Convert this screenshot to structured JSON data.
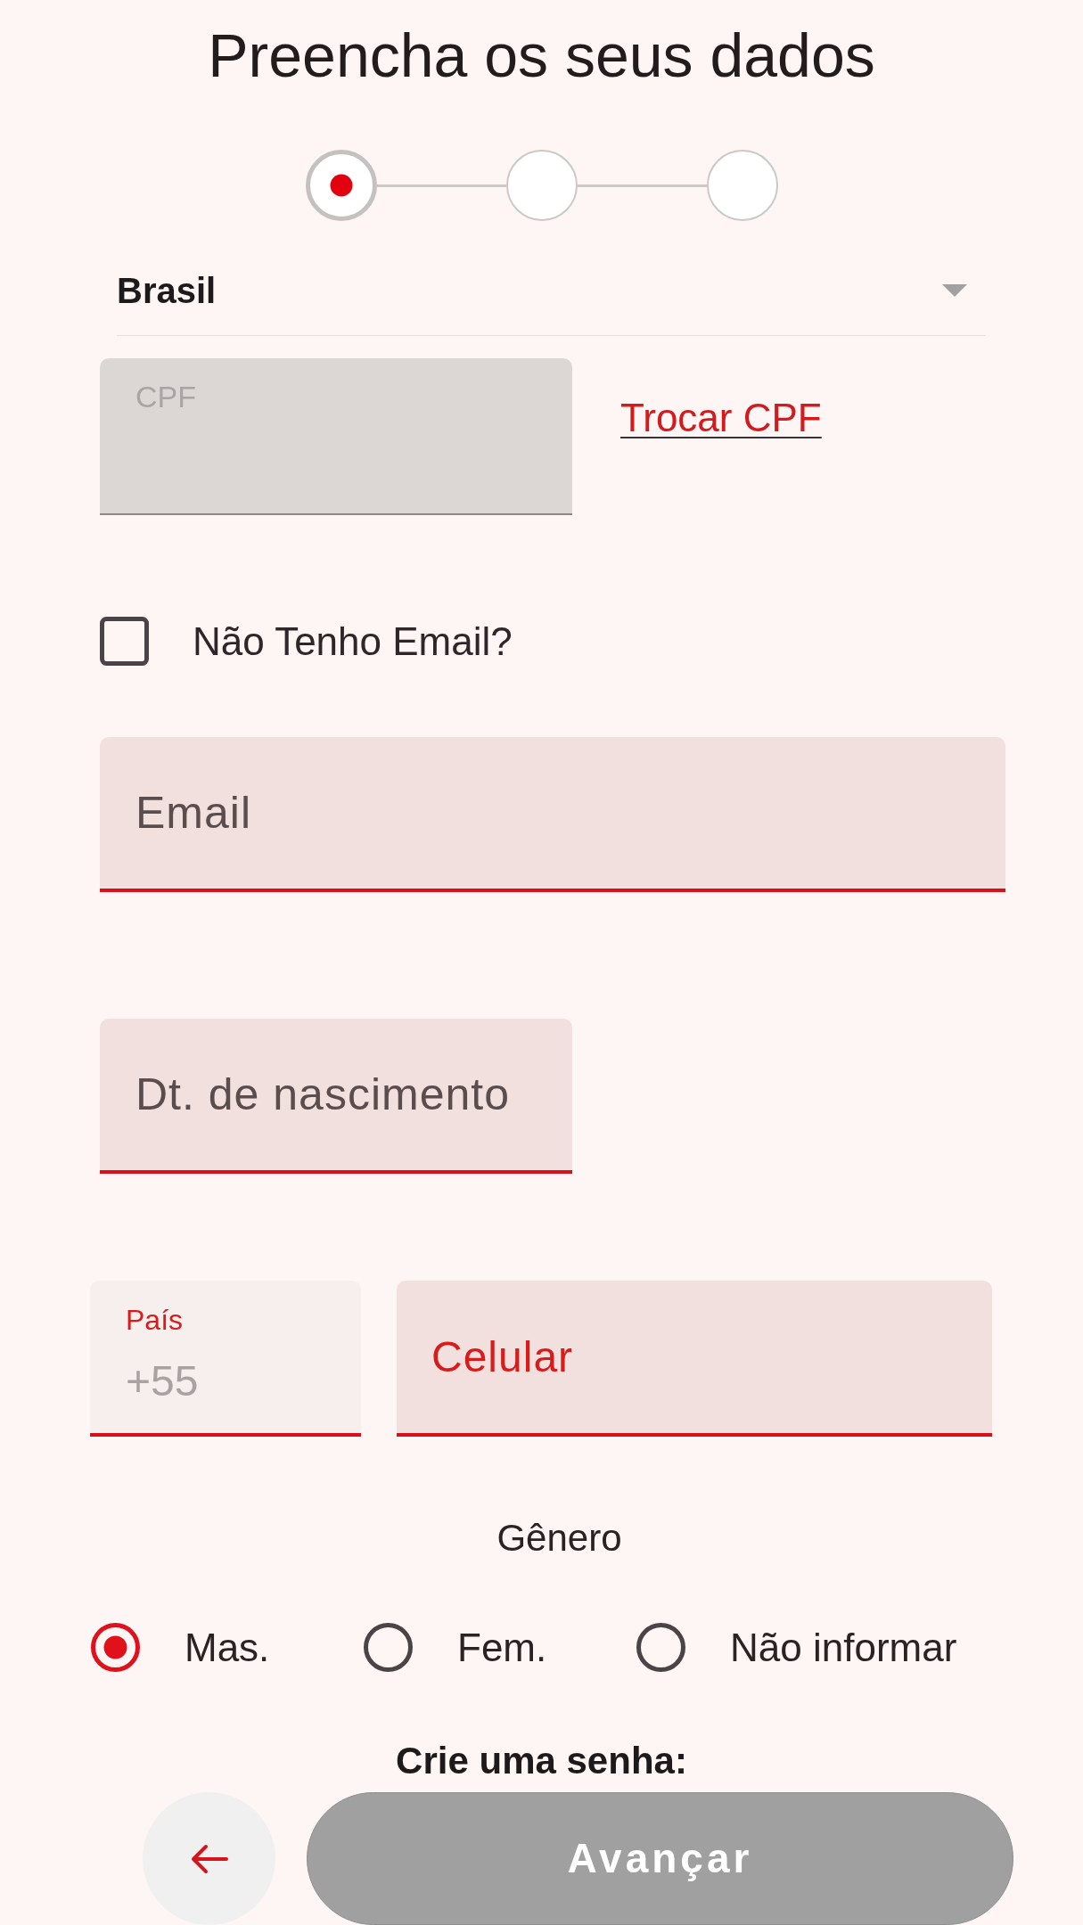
{
  "title": "Preencha os seus dados",
  "stepper": {
    "steps": [
      {
        "selected": true
      },
      {
        "selected": false
      },
      {
        "selected": false
      }
    ]
  },
  "country_select": {
    "value": "Brasil"
  },
  "cpf_field": {
    "label": "CPF",
    "disabled": true
  },
  "change_cpf_link": {
    "label": "Trocar CPF"
  },
  "no_email_checkbox": {
    "label": "Não Tenho Email?",
    "checked": false
  },
  "email_field": {
    "placeholder": "Email"
  },
  "birth_date_field": {
    "placeholder": "Dt. de nascimento"
  },
  "phone": {
    "country_code": {
      "label": "País",
      "value": "+55"
    },
    "number": {
      "placeholder": "Celular"
    }
  },
  "gender": {
    "label": "Gênero",
    "options": [
      {
        "label": "Mas.",
        "selected": true
      },
      {
        "label": "Fem.",
        "selected": false
      },
      {
        "label": "Não informar",
        "selected": false
      }
    ]
  },
  "password_heading": "Crie uma senha:",
  "next_button": {
    "label": "Avançar",
    "disabled": true
  }
}
